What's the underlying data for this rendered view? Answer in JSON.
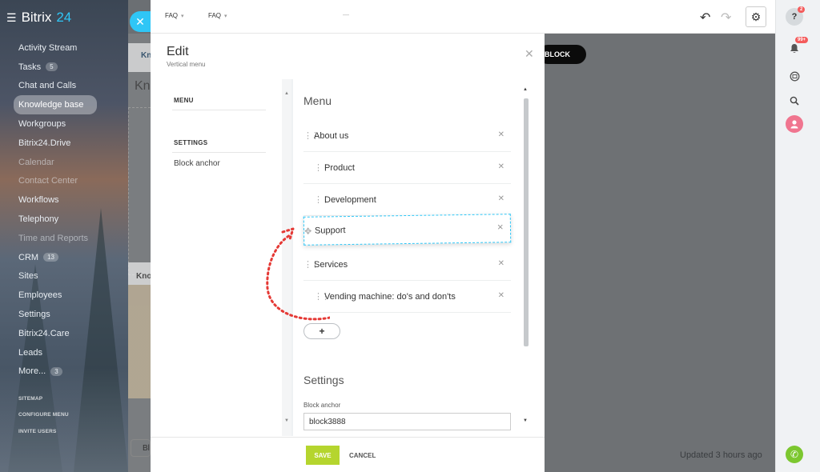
{
  "app": {
    "name": "Bitrix",
    "version": "24"
  },
  "sidebar": {
    "items": [
      {
        "label": "Activity Stream"
      },
      {
        "label": "Tasks",
        "count": "5"
      },
      {
        "label": "Chat and Calls"
      },
      {
        "label": "Knowledge base",
        "active": true
      },
      {
        "label": "Workgroups"
      },
      {
        "label": "Bitrix24.Drive"
      },
      {
        "label": "Calendar",
        "dim": true
      },
      {
        "label": "Contact Center",
        "dim": true
      },
      {
        "label": "Workflows"
      },
      {
        "label": "Telephony"
      },
      {
        "label": "Time and Reports",
        "dim": true
      },
      {
        "label": "CRM",
        "count": "13"
      },
      {
        "label": "Sites"
      },
      {
        "label": "Employees"
      },
      {
        "label": "Settings"
      },
      {
        "label": "Bitrix24.Care"
      },
      {
        "label": "Leads"
      },
      {
        "label": "More...",
        "count": "3"
      }
    ],
    "footer": [
      "SITEMAP",
      "CONFIGURE MENU",
      "INVITE USERS"
    ]
  },
  "topbar": {
    "crumb1": "FAQ",
    "sep": "—",
    "crumb2": "FAQ"
  },
  "background": {
    "tab_label": "Kn",
    "heading": "Kn",
    "card_label": "Kno",
    "button_label": "Bl",
    "block_button": "BLOCK",
    "updated": "Updated 3 hours ago"
  },
  "rightbar": {
    "help_badge": "2",
    "bell_badge": "99+"
  },
  "modal": {
    "title": "Edit",
    "subtitle": "Vertical menu",
    "side": {
      "menu_head": "MENU",
      "settings_head": "SETTINGS",
      "item": "Block anchor"
    },
    "content": {
      "menu_title": "Menu",
      "items": [
        {
          "label": "About us"
        },
        {
          "label": "Product"
        },
        {
          "label": "Development"
        },
        {
          "label": "Support"
        },
        {
          "label": "Services"
        },
        {
          "label": "Vending machine: do's and don'ts"
        }
      ],
      "add_label": "+",
      "settings_title": "Settings",
      "anchor_label": "Block anchor",
      "anchor_value": "block3888"
    },
    "footer": {
      "save": "SAVE",
      "cancel": "CANCEL"
    }
  },
  "colors": {
    "accent": "#2fc6f6",
    "save": "#b5d52e",
    "arrow": "#e53935",
    "badge": "#f45b5b"
  }
}
